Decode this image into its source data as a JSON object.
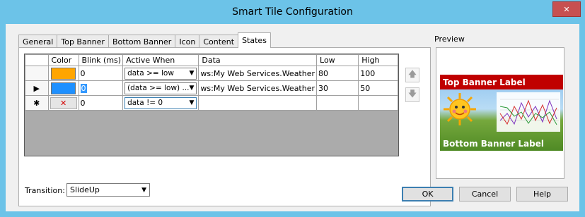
{
  "window": {
    "title": "Smart Tile Configuration",
    "close_glyph": "✕"
  },
  "tabs": [
    {
      "label": "General"
    },
    {
      "label": "Top Banner"
    },
    {
      "label": "Bottom Banner"
    },
    {
      "label": "Icon"
    },
    {
      "label": "Content"
    },
    {
      "label": "States",
      "active": true
    }
  ],
  "grid": {
    "columns": [
      "Color",
      "Blink (ms)",
      "Active When",
      "Data",
      "Low",
      "High"
    ],
    "rows": [
      {
        "indicator": "",
        "color": "#ffa500",
        "blink": "0",
        "active_when": "data >= low",
        "data": "ws:My Web Services.Weather",
        "low": "80",
        "high": "100"
      },
      {
        "indicator": "▶",
        "color": "#1e90ff",
        "blink": "0",
        "active_when": "(data >= low) ...",
        "data": "ws:My Web Services.Weather",
        "low": "30",
        "high": "50"
      },
      {
        "indicator": "✱",
        "color_button": "✕",
        "blink": "0",
        "active_when": "data != 0",
        "data": "",
        "low": "",
        "high": ""
      }
    ]
  },
  "move": {
    "up_icon": "arrow-up-icon",
    "down_icon": "arrow-down-icon",
    "up_glyph": "🡅",
    "down_glyph": "🡇"
  },
  "transition": {
    "label": "Transition:",
    "value": "SlideUp"
  },
  "preview": {
    "label": "Preview",
    "top_banner": "Top Banner Label",
    "bottom_banner": "Bottom Banner Label",
    "banner_color": "#c00000"
  },
  "buttons": {
    "ok": "OK",
    "cancel": "Cancel",
    "help": "Help"
  },
  "colors": {
    "titlebar": "#6cc3e8",
    "close": "#c75050",
    "selection": "#3399ff"
  }
}
